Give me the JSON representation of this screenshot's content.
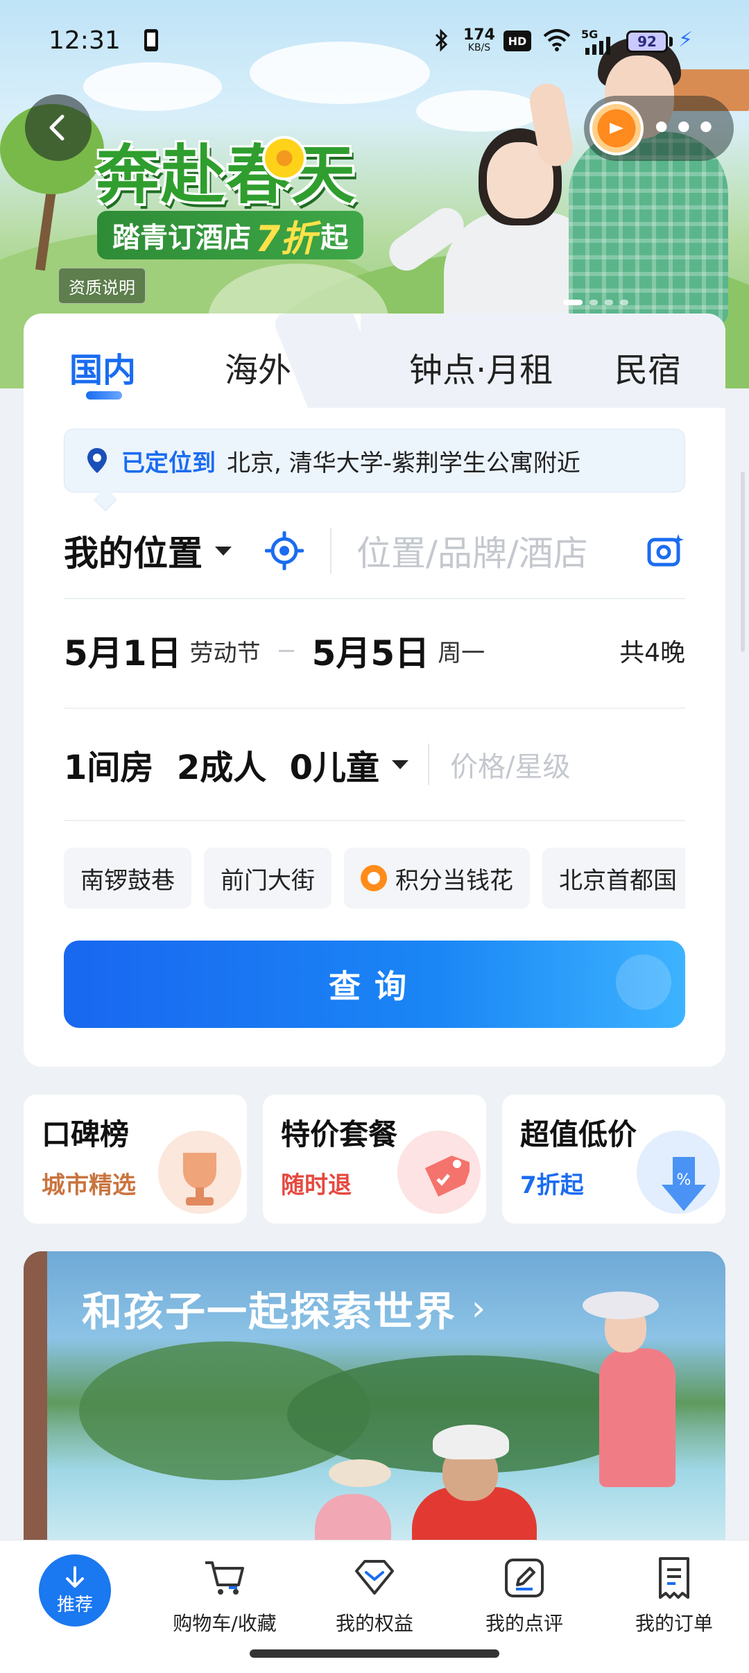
{
  "status_bar": {
    "time": "12:31",
    "net_speed_top": "174",
    "net_speed_bottom": "KB/S",
    "hd_badge": "HD",
    "signal_badge": "5G",
    "battery": "92",
    "icons": [
      "phone-rotate-icon",
      "bluetooth-icon",
      "wifi-icon",
      "signal-icon",
      "battery-icon",
      "charging-icon"
    ]
  },
  "banner": {
    "title": "奔赴春天",
    "subtitle_prefix": "踏青订酒店",
    "subtitle_highlight": "7折",
    "subtitle_suffix": "起",
    "qualification_label": "资质说明",
    "colors": {
      "title_green": "#2f9e2e",
      "subtitle_bg": "#2e8c36",
      "highlight": "#ffe24a"
    }
  },
  "header": {
    "back_icon": "chevron-left-icon",
    "reward_icon": "coin-icon",
    "more_label": "•••"
  },
  "search_card": {
    "tabs": [
      {
        "label": "国内",
        "active": true
      },
      {
        "label": "海外",
        "active": false
      },
      {
        "label": "钟点·月租",
        "active": false
      },
      {
        "label": "民宿",
        "active": false
      }
    ],
    "location_tip": {
      "status": "已定位到",
      "address": "北京, 清华大学-紫荆学生公寓附近"
    },
    "destination": {
      "value": "我的位置",
      "keyword_placeholder": "位置/品牌/酒店"
    },
    "dates": {
      "checkin": "5月1日",
      "checkin_note": "劳动节",
      "checkout": "5月5日",
      "checkout_note": "周一",
      "nights": "共4晚"
    },
    "guests": {
      "summary": "1间房  2成人  0儿童",
      "price_placeholder": "价格/星级"
    },
    "chips": [
      {
        "label": "南锣鼓巷",
        "icon": ""
      },
      {
        "label": "前门大街",
        "icon": ""
      },
      {
        "label": "积分当钱花",
        "icon": "points-icon"
      },
      {
        "label": "北京首都国",
        "icon": ""
      }
    ],
    "search_button": "查询",
    "colors": {
      "accent": "#1a6cf0"
    }
  },
  "promos": [
    {
      "title": "口碑榜",
      "subtitle": "城市精选",
      "color": "#c9743f"
    },
    {
      "title": "特价套餐",
      "subtitle": "随时退",
      "color": "#e5493f"
    },
    {
      "title": "超值低价",
      "subtitle": "7折起",
      "color": "#1a6cf0"
    }
  ],
  "feature": {
    "title": "和孩子一起探索世界",
    "chevron": "›"
  },
  "bottom_nav": {
    "recommend": "推荐",
    "items": [
      {
        "label": "购物车/收藏",
        "icon": "cart-icon"
      },
      {
        "label": "我的权益",
        "icon": "diamond-icon"
      },
      {
        "label": "我的点评",
        "icon": "review-edit-icon"
      },
      {
        "label": "我的订单",
        "icon": "order-list-icon"
      }
    ]
  }
}
